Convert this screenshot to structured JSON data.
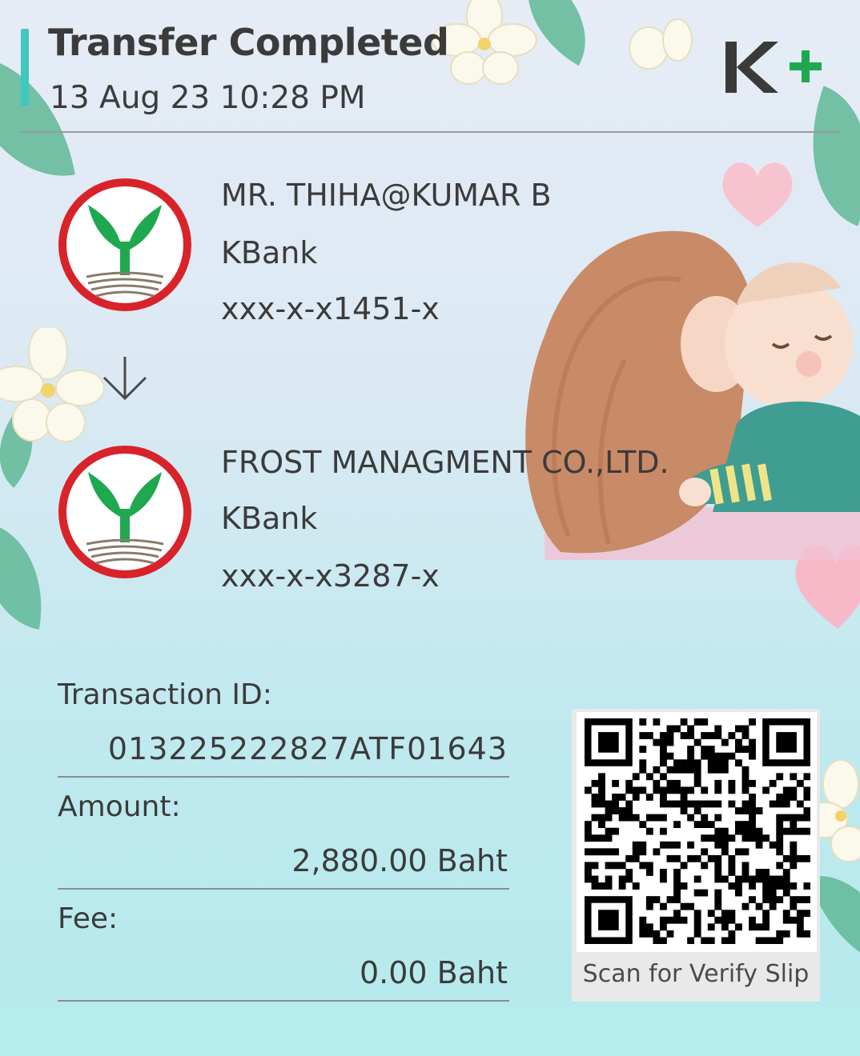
{
  "header": {
    "title": "Transfer Completed",
    "datetime": "13 Aug 23  10:28 PM",
    "brand": "K+"
  },
  "sender": {
    "name": "MR. THIHA@KUMAR B",
    "bank": "KBank",
    "account": "xxx-x-x1451-x"
  },
  "receiver": {
    "name": "FROST MANAGMENT CO.,LTD.",
    "bank": "KBank",
    "account": "xxx-x-x3287-x"
  },
  "details": {
    "transaction_id_label": "Transaction ID:",
    "transaction_id": "013225222827ATF01643",
    "amount_label": "Amount:",
    "amount": "2,880.00 Baht",
    "fee_label": "Fee:",
    "fee": "0.00 Baht"
  },
  "qr": {
    "caption": "Scan for Verify Slip"
  },
  "colors": {
    "accent": "#3fc7c0",
    "brand_green": "#1fa84f",
    "logo_red": "#d9232a"
  },
  "icons": {
    "arrow": "arrow-down-icon",
    "bank_logo": "kbank-logo-icon",
    "qr": "qr-code-icon"
  }
}
